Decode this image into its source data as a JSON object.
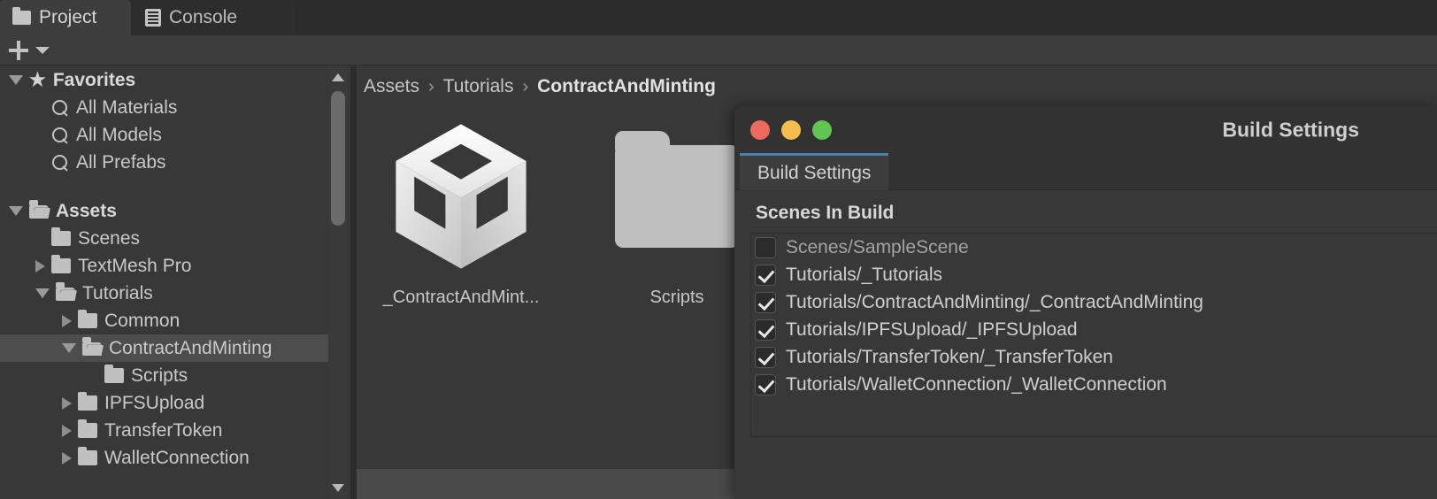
{
  "tabs": [
    {
      "label": "Project",
      "icon": "folder-icon",
      "active": true
    },
    {
      "label": "Console",
      "icon": "console-icon",
      "active": false
    }
  ],
  "toolbar": {
    "add_label": "+",
    "dropdown_icon": "caret-down-icon"
  },
  "sidebar": {
    "items": [
      {
        "label": "Favorites",
        "icon": "star-icon",
        "twisty": "open",
        "indent": 0,
        "bold": true,
        "selected": false
      },
      {
        "label": "All Materials",
        "icon": "search-icon",
        "twisty": "none",
        "indent": 1,
        "bold": false,
        "selected": false
      },
      {
        "label": "All Models",
        "icon": "search-icon",
        "twisty": "none",
        "indent": 1,
        "bold": false,
        "selected": false
      },
      {
        "label": "All Prefabs",
        "icon": "search-icon",
        "twisty": "none",
        "indent": 1,
        "bold": false,
        "selected": false
      },
      {
        "label": "",
        "icon": "spacer",
        "twisty": "none",
        "indent": 0,
        "bold": false,
        "selected": false
      },
      {
        "label": "Assets",
        "icon": "folder-open-icon",
        "twisty": "open",
        "indent": 0,
        "bold": true,
        "selected": false
      },
      {
        "label": "Scenes",
        "icon": "folder-icon",
        "twisty": "none",
        "indent": 1,
        "bold": false,
        "selected": false
      },
      {
        "label": "TextMesh Pro",
        "icon": "folder-icon",
        "twisty": "closed",
        "indent": 1,
        "bold": false,
        "selected": false
      },
      {
        "label": "Tutorials",
        "icon": "folder-open-icon",
        "twisty": "open",
        "indent": 1,
        "bold": false,
        "selected": false
      },
      {
        "label": "Common",
        "icon": "folder-icon",
        "twisty": "closed",
        "indent": 2,
        "bold": false,
        "selected": false
      },
      {
        "label": "ContractAndMinting",
        "icon": "folder-open-icon",
        "twisty": "open",
        "indent": 2,
        "bold": false,
        "selected": true
      },
      {
        "label": "Scripts",
        "icon": "folder-icon",
        "twisty": "none",
        "indent": 3,
        "bold": false,
        "selected": false
      },
      {
        "label": "IPFSUpload",
        "icon": "folder-icon",
        "twisty": "closed",
        "indent": 2,
        "bold": false,
        "selected": false
      },
      {
        "label": "TransferToken",
        "icon": "folder-icon",
        "twisty": "closed",
        "indent": 2,
        "bold": false,
        "selected": false
      },
      {
        "label": "WalletConnection",
        "icon": "folder-icon",
        "twisty": "closed",
        "indent": 2,
        "bold": false,
        "selected": false
      }
    ],
    "scrollbar": {
      "up_icon": "scroll-up-arrow-icon",
      "down_icon": "scroll-down-arrow-icon"
    }
  },
  "content": {
    "breadcrumb": [
      {
        "label": "Assets",
        "last": false
      },
      {
        "label": "Tutorials",
        "last": false
      },
      {
        "label": "ContractAndMinting",
        "last": true
      }
    ],
    "breadcrumb_separator": "›",
    "assets": [
      {
        "label": "_ContractAndMint...",
        "icon": "unity-scene-icon"
      },
      {
        "label": "Scripts",
        "icon": "folder-icon"
      }
    ]
  },
  "dialog": {
    "title": "Build Settings",
    "tab_label": "Build Settings",
    "window_buttons": [
      {
        "name": "close",
        "color": "#ee6a5f"
      },
      {
        "name": "minimize",
        "color": "#f5bd4f"
      },
      {
        "name": "zoom",
        "color": "#61c454"
      }
    ],
    "section_title": "Scenes In Build",
    "accent_color": "#4a7fb5",
    "scenes": [
      {
        "path": "Scenes/SampleScene",
        "checked": false
      },
      {
        "path": "Tutorials/_Tutorials",
        "checked": true
      },
      {
        "path": "Tutorials/ContractAndMinting/_ContractAndMinting",
        "checked": true
      },
      {
        "path": "Tutorials/IPFSUpload/_IPFSUpload",
        "checked": true
      },
      {
        "path": "Tutorials/TransferToken/_TransferToken",
        "checked": true
      },
      {
        "path": "Tutorials/WalletConnection/_WalletConnection",
        "checked": true
      }
    ]
  }
}
